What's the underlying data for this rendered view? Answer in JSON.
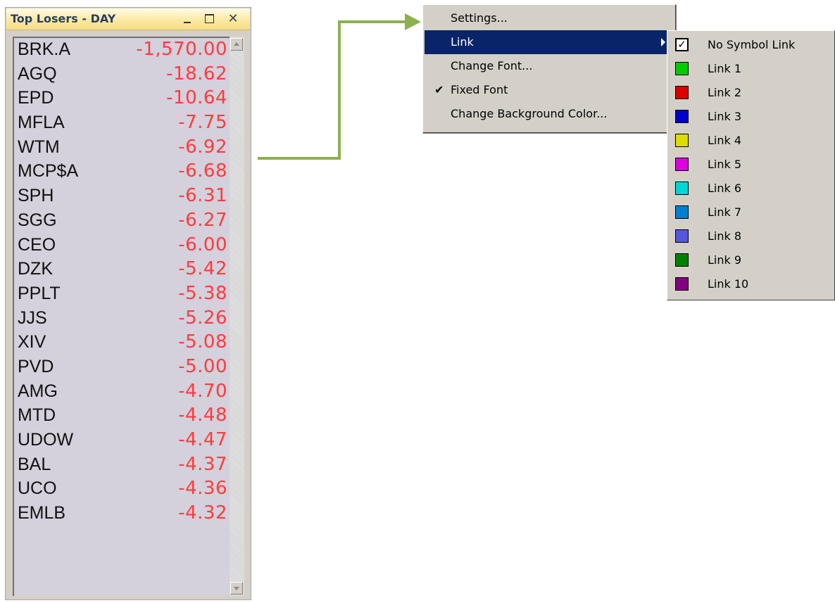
{
  "window": {
    "title": "Top Losers - DAY",
    "close_glyph": "✕"
  },
  "rows": [
    {
      "symbol": "BRK.A",
      "change": "-1,570.00"
    },
    {
      "symbol": "AGQ",
      "change": "-18.62"
    },
    {
      "symbol": "EPD",
      "change": "-10.64"
    },
    {
      "symbol": "MFLA",
      "change": "-7.75"
    },
    {
      "symbol": "WTM",
      "change": "-6.92"
    },
    {
      "symbol": "MCP$A",
      "change": "-6.68"
    },
    {
      "symbol": "SPH",
      "change": "-6.31"
    },
    {
      "symbol": "SGG",
      "change": "-6.27"
    },
    {
      "symbol": "CEO",
      "change": "-6.00"
    },
    {
      "symbol": "DZK",
      "change": "-5.42"
    },
    {
      "symbol": "PPLT",
      "change": "-5.38"
    },
    {
      "symbol": "JJS",
      "change": "-5.26"
    },
    {
      "symbol": "XIV",
      "change": "-5.08"
    },
    {
      "symbol": "PVD",
      "change": "-5.00"
    },
    {
      "symbol": "AMG",
      "change": "-4.70"
    },
    {
      "symbol": "MTD",
      "change": "-4.48"
    },
    {
      "symbol": "UDOW",
      "change": "-4.47"
    },
    {
      "symbol": "BAL",
      "change": "-4.37"
    },
    {
      "symbol": "UCO",
      "change": "-4.36"
    },
    {
      "symbol": "EMLB",
      "change": "-4.32"
    }
  ],
  "menu": {
    "items": [
      {
        "label": "Settings..."
      },
      {
        "label": "Link",
        "highlighted": true,
        "has_submenu": true
      },
      {
        "label": "Change Font..."
      },
      {
        "label": "Fixed Font",
        "checked": true,
        "check_glyph": "✔"
      },
      {
        "label": "Change Background Color..."
      }
    ]
  },
  "submenu": {
    "items": [
      {
        "label": "No Symbol Link",
        "checked": true,
        "check_glyph": "✓"
      },
      {
        "label": "Link 1",
        "color": "#00cc00"
      },
      {
        "label": "Link 2",
        "color": "#dd0000"
      },
      {
        "label": "Link 3",
        "color": "#0000cc"
      },
      {
        "label": "Link 4",
        "color": "#dddd00"
      },
      {
        "label": "Link 5",
        "color": "#dd00dd"
      },
      {
        "label": "Link 6",
        "color": "#00d6d6"
      },
      {
        "label": "Link 7",
        "color": "#0080d0"
      },
      {
        "label": "Link 8",
        "color": "#5555dd"
      },
      {
        "label": "Link 9",
        "color": "#008000"
      },
      {
        "label": "Link 10",
        "color": "#800080"
      }
    ]
  },
  "colors": {
    "arrow": "#8db050",
    "change_text": "#ff3b3b",
    "menu_highlight": "#0a246a"
  }
}
